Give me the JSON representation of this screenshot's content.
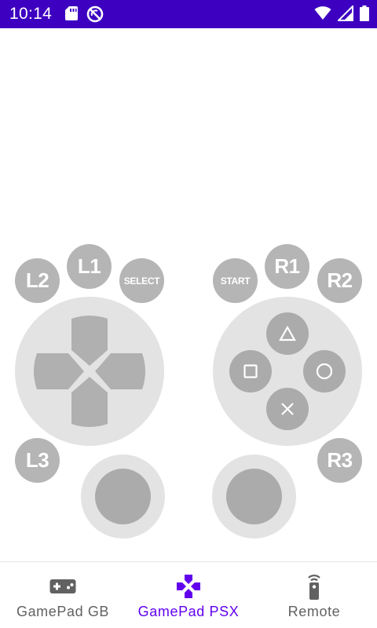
{
  "status_bar": {
    "time": "10:14",
    "background": "#3d00c0",
    "left_icons": [
      "sd-card-icon",
      "no-sync-icon"
    ],
    "right_icons": [
      "wifi-icon",
      "cell-signal-icon",
      "battery-icon"
    ]
  },
  "gamepad": {
    "left_shoulder": {
      "l2": "L2",
      "l1": "L1",
      "select": "SELECT"
    },
    "right_shoulder": {
      "start": "START",
      "r1": "R1",
      "r2": "R2"
    },
    "l3": "L3",
    "r3": "R3",
    "face_buttons": [
      "triangle-icon",
      "square-icon",
      "circle-icon",
      "cross-icon"
    ],
    "dpad": [
      "up",
      "left",
      "right",
      "down"
    ]
  },
  "bottom_nav": {
    "active_color": "#6200ee",
    "items": [
      {
        "label": "GamePad GB",
        "icon": "gamepad-icon",
        "active": false
      },
      {
        "label": "GamePad PSX",
        "icon": "dpad-cross-icon",
        "active": true
      },
      {
        "label": "Remote",
        "icon": "remote-icon",
        "active": false
      }
    ]
  }
}
